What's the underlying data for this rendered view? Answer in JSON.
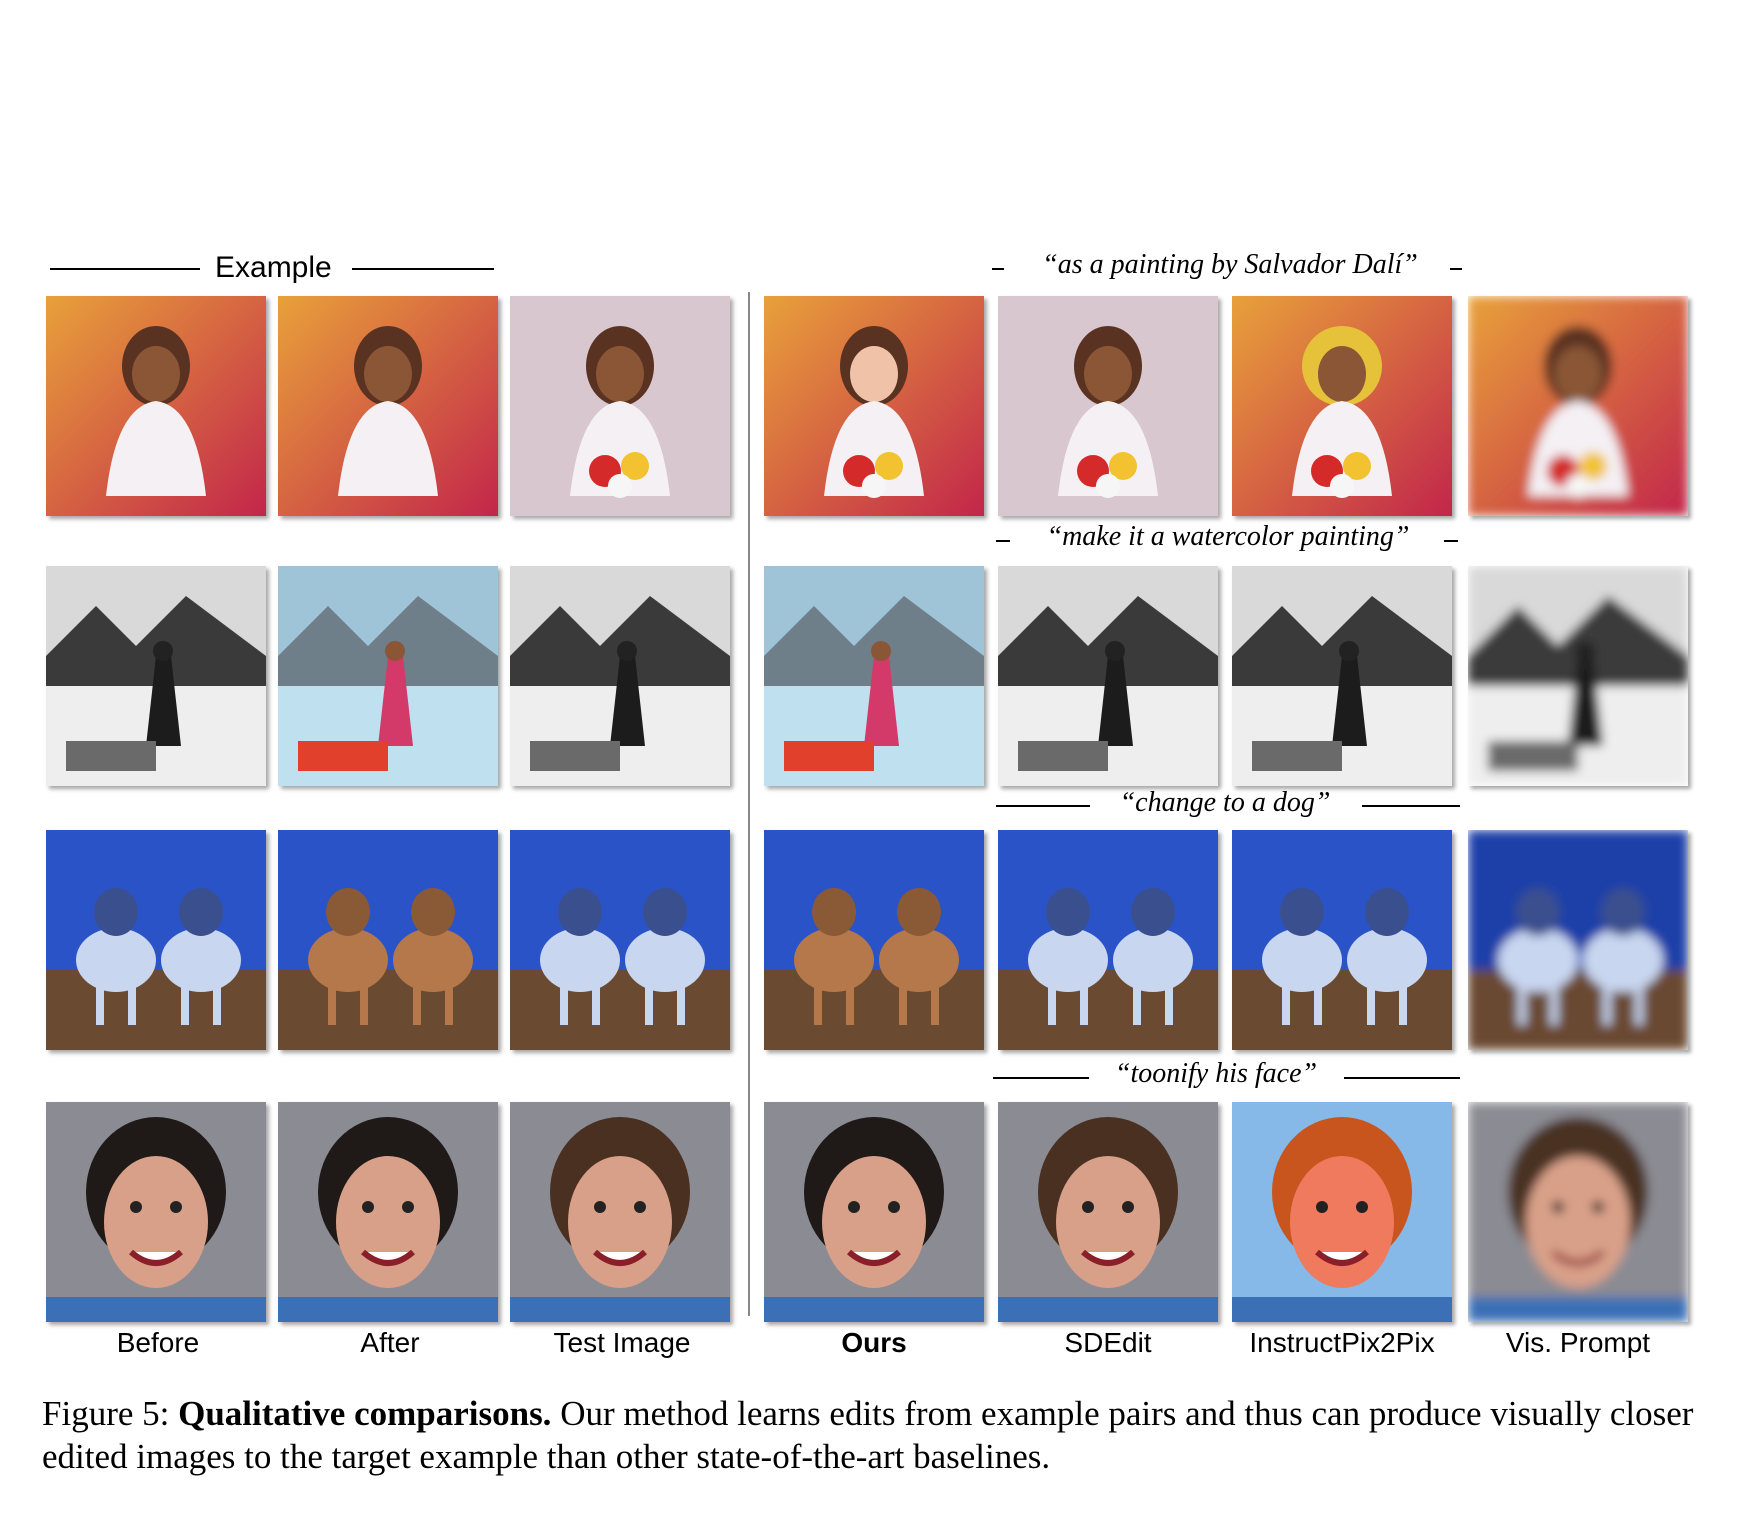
{
  "figure": {
    "example_header": "Example",
    "prompts": [
      "“as a painting by Salvador Dalí”",
      "“make it a watercolor painting”",
      "“change to a dog”",
      "“toonify his face”"
    ],
    "column_labels": [
      "Before",
      "After",
      "Test Image",
      "Ours",
      "SDEdit",
      "InstructPix2Pix",
      "Vis. Prompt"
    ],
    "rows": [
      {
        "subject": "girl-painting",
        "palette": [
          "#e8a13a",
          "#c2264a",
          "#f4f0f4",
          "#5a3222"
        ]
      },
      {
        "subject": "flower-seller",
        "palette": [
          "#8a8a8a",
          "#e64b8e",
          "#2f2f2f",
          "#cfd9e6"
        ]
      },
      {
        "subject": "wolf-to-dog",
        "palette": [
          "#2a53c8",
          "#e8f0ff",
          "#6a4a30",
          "#b3c7ea"
        ]
      },
      {
        "subject": "portrait-face",
        "palette": [
          "#1f1a18",
          "#d9a089",
          "#8b8b93",
          "#3b6fb6"
        ]
      }
    ]
  },
  "caption": {
    "prefix": "Figure 5:",
    "bold": "Qualitative comparisons.",
    "text": "Our method learns edits from example pairs and thus can produce visually closer edited images to the target example than other state-of-the-art baselines."
  }
}
